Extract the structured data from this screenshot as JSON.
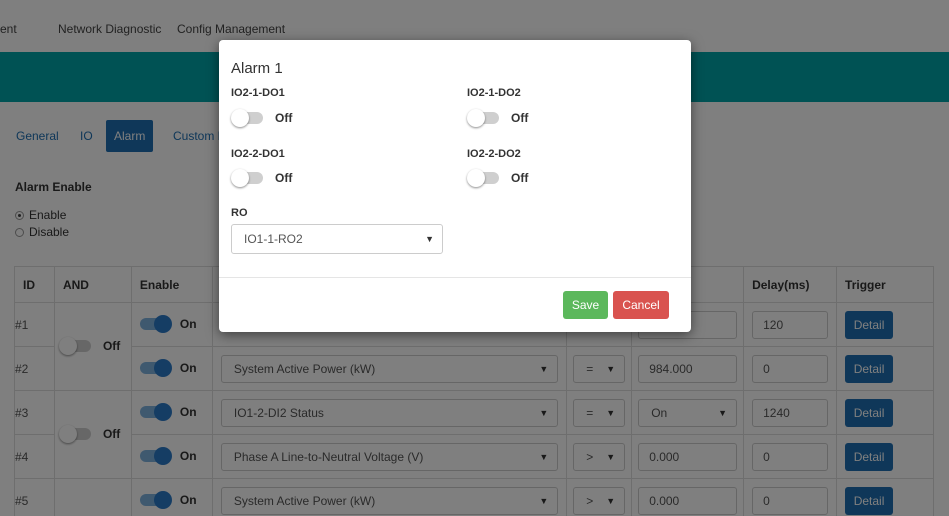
{
  "nav": {
    "items": [
      "ent",
      "Network Diagnostic",
      "Config Management"
    ]
  },
  "tabs": [
    "General",
    "IO",
    "Alarm",
    "Custom F"
  ],
  "alarm_enable": {
    "label": "Alarm Enable",
    "options": [
      "Enable",
      "Disable"
    ],
    "selected": "Enable"
  },
  "table": {
    "headers": [
      "ID",
      "AND",
      "Enable",
      "",
      "",
      "",
      "Delay(ms)",
      "Trigger"
    ],
    "rows": [
      {
        "id": "#1",
        "enable": "On",
        "param": "",
        "op": "",
        "value": "",
        "delay": "120",
        "trigger": "Detail"
      },
      {
        "id": "#2",
        "enable": "On",
        "param": "System Active Power (kW)",
        "op": "=",
        "value": "984.000",
        "delay": "0",
        "trigger": "Detail"
      },
      {
        "id": "#3",
        "enable": "On",
        "param": "IO1-2-DI2 Status",
        "op": "=",
        "value": "On",
        "delay": "1240",
        "trigger": "Detail"
      },
      {
        "id": "#4",
        "enable": "On",
        "param": "Phase A Line-to-Neutral Voltage (V)",
        "op": ">",
        "value": "0.000",
        "delay": "0",
        "trigger": "Detail"
      },
      {
        "id": "#5",
        "enable": "On",
        "param": "System Active Power (kW)",
        "op": ">",
        "value": "0.000",
        "delay": "0",
        "trigger": "Detail"
      }
    ],
    "and_groups": [
      "Off",
      "Off"
    ]
  },
  "modal": {
    "title": "Alarm 1",
    "outputs": [
      {
        "label": "IO2-1-DO1",
        "state": "Off"
      },
      {
        "label": "IO2-1-DO2",
        "state": "Off"
      },
      {
        "label": "IO2-2-DO1",
        "state": "Off"
      },
      {
        "label": "IO2-2-DO2",
        "state": "Off"
      }
    ],
    "ro_label": "RO",
    "ro_value": "IO1-1-RO2",
    "save_label": "Save",
    "cancel_label": "Cancel"
  },
  "colors": {
    "teal": "#00a5a9",
    "primary": "#1f6fb2",
    "save": "#5cb85c",
    "cancel": "#d9534f"
  },
  "icons": {
    "caret": "caret-down-icon"
  }
}
